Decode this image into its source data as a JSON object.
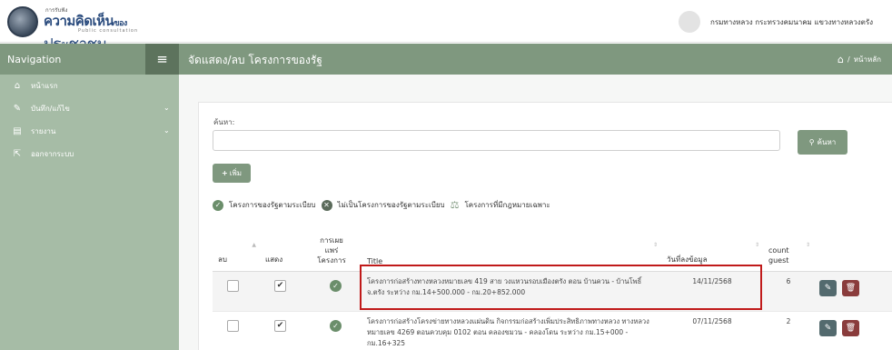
{
  "header": {
    "logo_small": "การรับฟัง",
    "logo_main": "ความคิดเห็น",
    "logo_of": "ของ",
    "logo_brand": "ประชาชน",
    "logo_sub": "Public consultation",
    "user_name": "กรมทางหลวง กระทรวงคมนาคม แขวงทางหลวงตรัง"
  },
  "sidebar": {
    "title": "Navigation",
    "items": [
      {
        "label": "หน้าแรก",
        "icon": "home-icon",
        "glyph": "⌂",
        "chevron": false
      },
      {
        "label": "บันทึก/แก้ไข",
        "icon": "edit-note-icon",
        "glyph": "✎",
        "chevron": true
      },
      {
        "label": "รายงาน",
        "icon": "report-icon",
        "glyph": "▤",
        "chevron": true
      },
      {
        "label": "ออกจากระบบ",
        "icon": "logout-icon",
        "glyph": "⇱",
        "chevron": false
      }
    ]
  },
  "page": {
    "title": "จัดแสดง/ลบ โครงการของรัฐ",
    "breadcrumb": "หน้าหลัก"
  },
  "search": {
    "label": "ค้นหา:",
    "value": "",
    "placeholder": "",
    "button": "ค้นหา"
  },
  "add_button": "เพิ่ม",
  "legend": {
    "ok": "โครงการของรัฐตามระเบียบ",
    "not": "ไม่เป็นโครงการของรัฐตามระเบียบ",
    "law": "โครงการที่มีกฎหมายเฉพาะ"
  },
  "table": {
    "headers": {
      "delete": "ลบ",
      "show": "แสดง",
      "publish": "การเผยแพร่โครงการ",
      "title": "Title",
      "date": "วันที่ลงข้อมูล",
      "count": "count guest"
    },
    "rows": [
      {
        "title": "โครงการก่อสร้างทางหลวงหมายเลข 419 สาย วงแหวนรอบเมืองตรัง ตอน บ้านควน - บ้านโพธิ์ จ.ตรัง ระหว่าง กม.14+500.000 - กม.20+852.000",
        "date": "14/11/2568",
        "count": "6",
        "show_checked": true,
        "published": true
      },
      {
        "title": "โครงการก่อสร้างโครงข่ายทางหลวงแผ่นดิน กิจกรรมก่อสร้างเพิ่มประสิทธิภาพทางหลวง ทางหลวงหมายเลข 4269 ตอนควบคุม 0102 ตอน คลองขมวน - คลองโดน ระหว่าง กม.15+000 - กม.16+325",
        "date": "07/11/2568",
        "count": "2",
        "show_checked": true,
        "published": true
      }
    ]
  },
  "colors": {
    "brand_green": "#7f987f",
    "sidebar_bg": "#a6bca6",
    "highlight_red": "#c01a1a",
    "delete_red": "#8a3c3c",
    "edit_slate": "#536a6e"
  }
}
